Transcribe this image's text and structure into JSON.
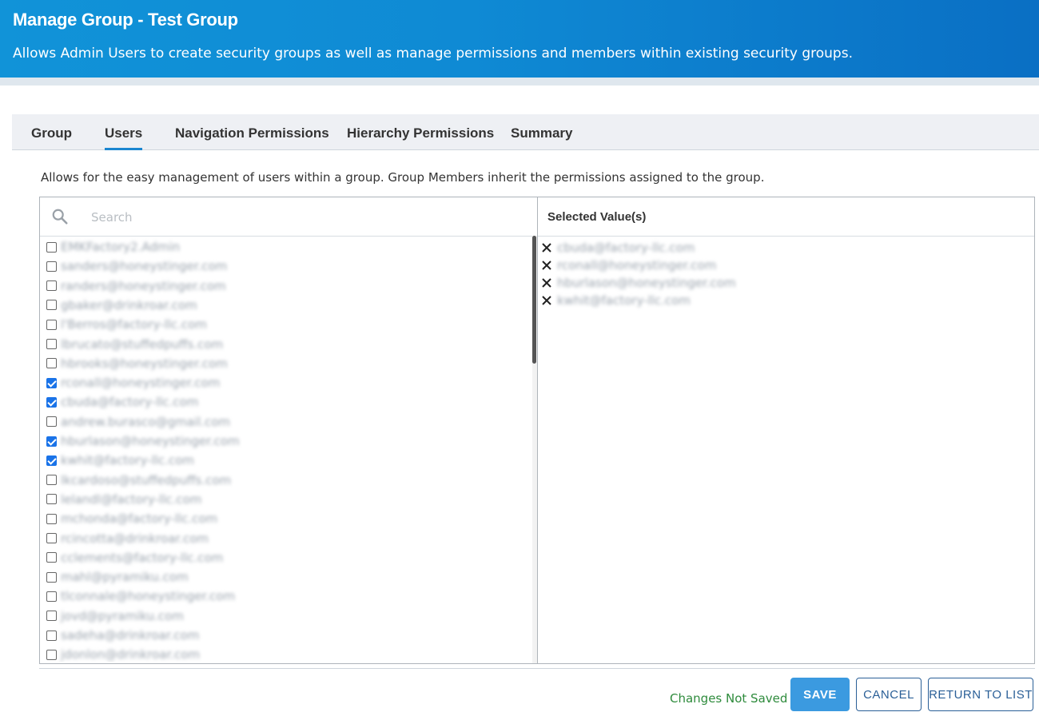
{
  "header": {
    "title": "Manage Group - Test Group",
    "subtitle": "Allows Admin Users to create security groups as well as manage permissions and members within existing security groups."
  },
  "tabs": [
    {
      "label": "Group",
      "active": false
    },
    {
      "label": "Users",
      "active": true
    },
    {
      "label": "Navigation Permissions",
      "active": false
    },
    {
      "label": "Hierarchy Permissions",
      "active": false
    },
    {
      "label": "Summary",
      "active": false
    }
  ],
  "description": "Allows for the easy management of users within a group. Group Members inherit the permissions assigned to the group.",
  "search": {
    "placeholder": "Search",
    "value": "",
    "icon": "search-icon"
  },
  "users": [
    {
      "email": "EMKFactory2.Admin",
      "checked": false
    },
    {
      "email": "sanders@honeystinger.com",
      "checked": false
    },
    {
      "email": "randers@honeystinger.com",
      "checked": false
    },
    {
      "email": "gbaker@drinkroar.com",
      "checked": false
    },
    {
      "email": "l'Berros@factory-llc.com",
      "checked": false
    },
    {
      "email": "lbrucato@stuffedpuffs.com",
      "checked": false
    },
    {
      "email": "hbrooks@honeystinger.com",
      "checked": false
    },
    {
      "email": "rconall@honeystinger.com",
      "checked": true
    },
    {
      "email": "cbuda@factory-llc.com",
      "checked": true
    },
    {
      "email": "andrew.burasco@gmail.com",
      "checked": false
    },
    {
      "email": "hburlason@honeystinger.com",
      "checked": true
    },
    {
      "email": "kwhit@factory-llc.com",
      "checked": true
    },
    {
      "email": "lkcardoso@stuffedpuffs.com",
      "checked": false
    },
    {
      "email": "lelandl@factory-llc.com",
      "checked": false
    },
    {
      "email": "mchonda@factory-llc.com",
      "checked": false
    },
    {
      "email": "rcincotta@drinkroar.com",
      "checked": false
    },
    {
      "email": "cclements@factory-llc.com",
      "checked": false
    },
    {
      "email": "mahl@pyramiku.com",
      "checked": false
    },
    {
      "email": "tlconnale@honeystinger.com",
      "checked": false
    },
    {
      "email": "jovd@pyramiku.com",
      "checked": false
    },
    {
      "email": "sadeha@drinkroar.com",
      "checked": false
    },
    {
      "email": "jdonlon@drinkroar.com",
      "checked": false
    }
  ],
  "selected": {
    "header": "Selected Value(s)",
    "items": [
      {
        "email": "cbuda@factory-llc.com"
      },
      {
        "email": "rconall@honeystinger.com"
      },
      {
        "email": "hburlason@honeystinger.com"
      },
      {
        "email": "kwhit@factory-llc.com"
      }
    ]
  },
  "footer": {
    "status": "Changes Not Saved",
    "status_color": "#2e8b3c",
    "save_label": "SAVE",
    "cancel_label": "CANCEL",
    "return_label": "RETURN TO LIST"
  },
  "colors": {
    "header": "#0f8ad4",
    "accent": "#1a86d0",
    "checkbox": "#1a73e8"
  }
}
